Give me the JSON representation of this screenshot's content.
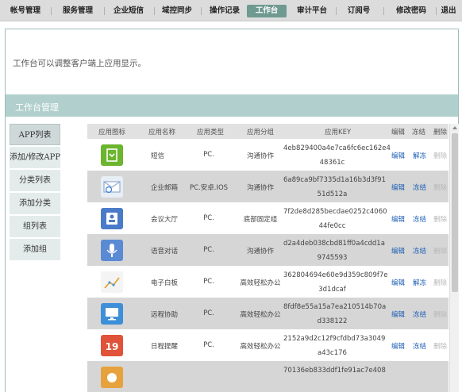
{
  "nav": {
    "items": [
      "帐号管理",
      "服务管理",
      "企业短信",
      "域控同步",
      "操作记录",
      "工作台",
      "审计平台",
      "订阅号",
      "修改密码",
      "退出"
    ],
    "active": "工作台"
  },
  "intro": "工作台可以调整客户端上应用显示。",
  "section_title": "工作台管理",
  "menu": [
    "APP列表",
    "添加/修改APP",
    "分类列表",
    "添加分类",
    "组列表",
    "添加组"
  ],
  "table": {
    "headers": [
      "应用图标",
      "应用名称",
      "应用类型",
      "应用分组",
      "应用KEY",
      "编辑",
      "冻结",
      "删除"
    ],
    "rows": [
      {
        "icon": "sms-icon",
        "color": "#6bb52f",
        "name": "短信",
        "type": "PC.",
        "group": "沟通协作",
        "key1": "4eb829400a4e7ca6fc6ec162e4",
        "key2": "48361c",
        "edit": "编辑",
        "freeze": "解冻",
        "del": "删除"
      },
      {
        "icon": "mail-icon",
        "color": "#e8eef5",
        "name": "企业邮箱",
        "type": "PC.安卓.IOS",
        "group": "沟通协作",
        "key1": "6a89ca9bf7335d1a16b3d3f91",
        "key2": "51d512a",
        "edit": "编辑",
        "freeze": "冻结",
        "del": "删除"
      },
      {
        "icon": "meeting-icon",
        "color": "#4a7bc9",
        "name": "会议大厅",
        "type": "PC.",
        "group": "底部固定组",
        "key1": "7f2de8d285becdae0252c4060",
        "key2": "44fe0cc",
        "edit": "编辑",
        "freeze": "冻结",
        "del": "删除"
      },
      {
        "icon": "microphone-icon",
        "color": "#5b8ad4",
        "name": "语音对话",
        "type": "PC.",
        "group": "沟通协作",
        "key1": "d2a4deb038cbd81ff0a4cdd1a",
        "key2": "9745593",
        "edit": "编辑",
        "freeze": "冻结",
        "del": "删除"
      },
      {
        "icon": "whiteboard-icon",
        "color": "#f4f4f4",
        "name": "电子白板",
        "type": "PC.",
        "group": "高效轻松办公",
        "key1": "362804694e60e9d359c809f7e",
        "key2": "3d1dcaf",
        "edit": "编辑",
        "freeze": "解冻",
        "del": "删除"
      },
      {
        "icon": "remote-assist-icon",
        "color": "#3d8fd8",
        "name": "远程协助",
        "type": "PC.",
        "group": "高效轻松办公",
        "key1": "8fdf8e55a15a7ea210514b70a",
        "key2": "d338122",
        "edit": "编辑",
        "freeze": "冻结",
        "del": "删除"
      },
      {
        "icon": "calendar-icon",
        "color": "#e0533a",
        "name": "日程提醒",
        "type": "PC.",
        "group": "高效轻松办公",
        "key1": "2152a9d2c12f9cfdbd73a3049",
        "key2": "a43c176",
        "edit": "编辑",
        "freeze": "冻结",
        "del": "删除"
      },
      {
        "icon": "app-icon",
        "color": "#e6a23c",
        "name": "",
        "type": "",
        "group": "",
        "key1": "70136eb833ddf1fe91ac7e408",
        "key2": "",
        "edit": "",
        "freeze": "",
        "del": ""
      }
    ]
  }
}
